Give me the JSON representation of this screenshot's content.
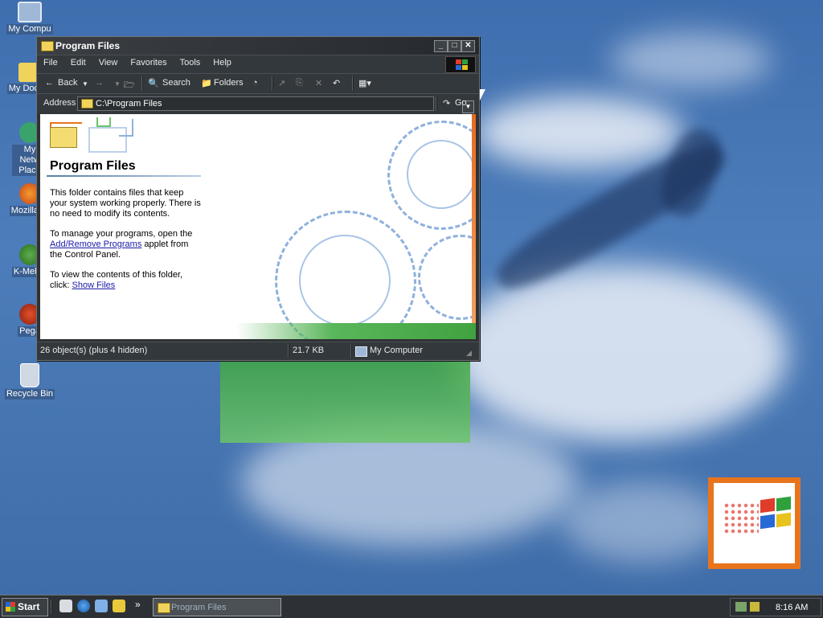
{
  "desktop": {
    "icons": [
      {
        "label": "My Computer",
        "name": "desktop-icon-my-computer"
      },
      {
        "label": "My Documents",
        "name": "desktop-icon-my-documents"
      },
      {
        "label": "My Network Places",
        "name": "desktop-icon-my-network-places"
      },
      {
        "label": "Mozilla Firefox",
        "name": "desktop-icon-mozilla-firefox"
      },
      {
        "label": "K-Meleon",
        "name": "desktop-icon-k-meleon"
      },
      {
        "label": "Pegasus",
        "name": "desktop-icon-pegasus"
      },
      {
        "label": "Recycle Bin",
        "name": "desktop-icon-recycle-bin"
      }
    ],
    "icon_labels_visible": [
      "My Compu",
      "My Docum",
      "My Netw Place",
      "Mozilla Fi",
      "K-Melec",
      "Pega",
      "Recycle Bin"
    ]
  },
  "window": {
    "title": "Program Files",
    "buttons": {
      "minimize": "_",
      "maximize": "□",
      "close": "✕"
    },
    "menu": [
      "File",
      "Edit",
      "View",
      "Favorites",
      "Tools",
      "Help"
    ],
    "toolbar": {
      "back": "Back",
      "search": "Search",
      "folders": "Folders"
    },
    "address": {
      "label": "Address",
      "value": "C:\\Program Files",
      "go": "Go"
    },
    "content": {
      "title": "Program Files",
      "para1": "This folder contains files that keep your system working properly. There is no need to modify its contents.",
      "para2_before": "To manage your programs, open the ",
      "para2_link": "Add/Remove Programs",
      "para2_after": " applet from the Control Panel.",
      "para3_before": "To view the contents of this folder, click: ",
      "para3_link": "Show Files"
    },
    "status": {
      "objects": "26 object(s) (plus 4 hidden)",
      "size": "21.7 KB",
      "zone": "My Computer"
    }
  },
  "taskbar": {
    "start": "Start",
    "task": "Program Files",
    "chevron": "»",
    "clock": "8:16 AM"
  },
  "colors": {
    "desktop_blue": "#4373b0",
    "window_chrome": "#33383c",
    "link": "#1a1aa8",
    "accent_orange": "#e8741c",
    "accent_green": "#3fa642"
  }
}
